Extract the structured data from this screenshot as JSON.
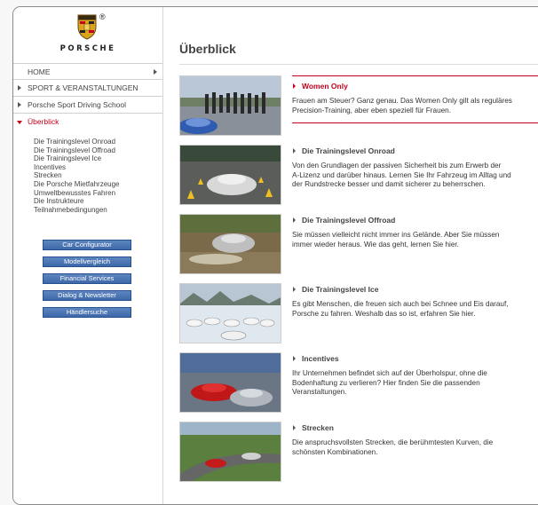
{
  "brand": {
    "wordmark": "PORSCHE",
    "reg": "®"
  },
  "nav": [
    {
      "label": "HOME",
      "arrow": "right-end"
    },
    {
      "label": "SPORT & VERANSTALTUNGEN",
      "arrow": "left"
    },
    {
      "label": "Porsche Sport Driving School",
      "arrow": "left"
    },
    {
      "label": "Überblick",
      "arrow": "down",
      "active": true
    }
  ],
  "subnav": [
    "Die Trainingslevel Onroad",
    "Die Trainingslevel Offroad",
    "Die Trainingslevel Ice",
    "Incentives",
    "Strecken",
    "Die Porsche Mietfahrzeuge",
    "Umweltbewusstes Fahren",
    "Die Instrukteure",
    "Teilnahmebedingungen"
  ],
  "buttons": [
    "Car Configurator",
    "Modellvergleich",
    "Financial Services",
    "Dialog & Newsletter",
    "Händlersuche"
  ],
  "page_title": "Überblick",
  "teasers": [
    {
      "title": "Women Only",
      "lines": [
        "Frauen am Steuer? Ganz genau. Das Women Only gilt als reguläres",
        "Precision-Training, aber eben speziell für Frauen."
      ],
      "highlight": true,
      "image": "women-group-photo"
    },
    {
      "title": "Die Trainingslevel Onroad",
      "lines": [
        "Von den Grundlagen der passiven Sicherheit bis zum Erwerb der",
        "A-Lizenz und darüber hinaus. Lernen Sie Ihr Fahrzeug im Alltag und",
        "der Rundstrecke besser und damit sicherer zu beherrschen."
      ],
      "image": "onroad-cones-photo"
    },
    {
      "title": "Die Trainingslevel Offroad",
      "lines": [
        "Sie müssen vielleicht nicht immer ins Gelände. Aber Sie müssen",
        "immer wieder heraus. Wie das geht, lernen Sie hier."
      ],
      "image": "offroad-water-photo"
    },
    {
      "title": "Die Trainingslevel Ice",
      "lines": [
        "Es gibt Menschen, die freuen sich auch bei Schnee und Eis darauf,",
        "Porsche zu fahren. Weshalb das so ist, erfahren Sie hier."
      ],
      "image": "ice-cars-photo"
    },
    {
      "title": "Incentives",
      "lines": [
        "Ihr Unternehmen befindet sich auf der Überholspur, ohne die",
        "Bodenhaftung zu verlieren? Hier finden Sie die passenden",
        "Veranstaltungen."
      ],
      "image": "incentives-cars-photo"
    },
    {
      "title": "Strecken",
      "lines": [
        "Die anspruchsvollsten Strecken, die berühmtesten Kurven, die",
        "schönsten Kombinationen."
      ],
      "image": "track-photo"
    }
  ],
  "colors": {
    "accent": "#c4001a",
    "button": "#4a73b3"
  }
}
